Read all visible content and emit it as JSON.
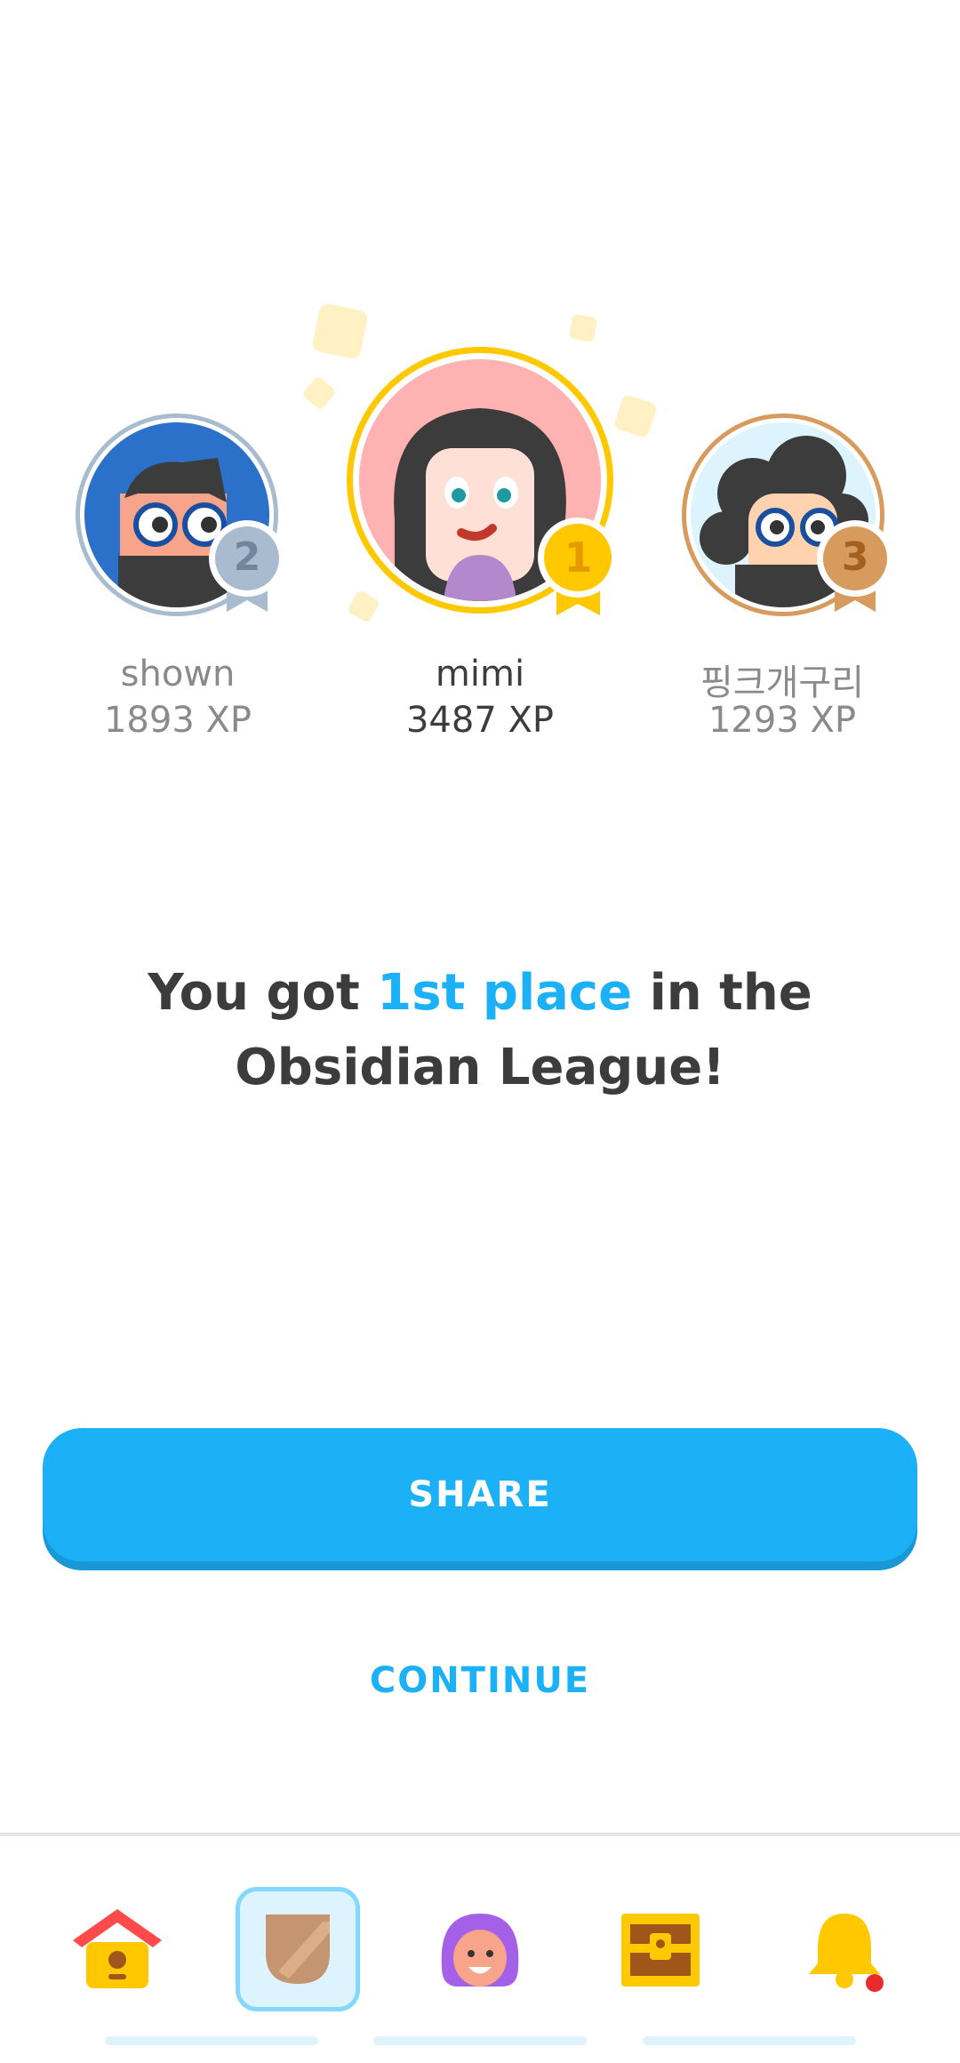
{
  "podium": [
    {
      "rank": "2",
      "name": "shown",
      "xp": "1893 XP",
      "medal_color": "#a9bccf",
      "ring_color": "#a9bccf"
    },
    {
      "rank": "1",
      "name": "mimi",
      "xp": "3487 XP",
      "medal_color": "#ffc800",
      "ring_color": "#ffc800"
    },
    {
      "rank": "3",
      "name": "핑크개구리",
      "xp": "1293 XP",
      "medal_color": "#d89b5e",
      "ring_color": "#d89b5e"
    }
  ],
  "headline": {
    "prefix": "You got ",
    "accent": "1st place",
    "suffix": " in the Obsidian League!"
  },
  "buttons": {
    "share": "SHARE",
    "continue": "CONTINUE"
  },
  "nav": [
    {
      "icon": "home-icon"
    },
    {
      "icon": "league-shield-icon",
      "active": true
    },
    {
      "icon": "profile-avatar-icon"
    },
    {
      "icon": "treasure-chest-icon"
    },
    {
      "icon": "notification-bell-icon"
    }
  ],
  "colors": {
    "accent": "#1cb0f6",
    "text": "#3c3c3c",
    "muted": "#8a8a8a"
  }
}
